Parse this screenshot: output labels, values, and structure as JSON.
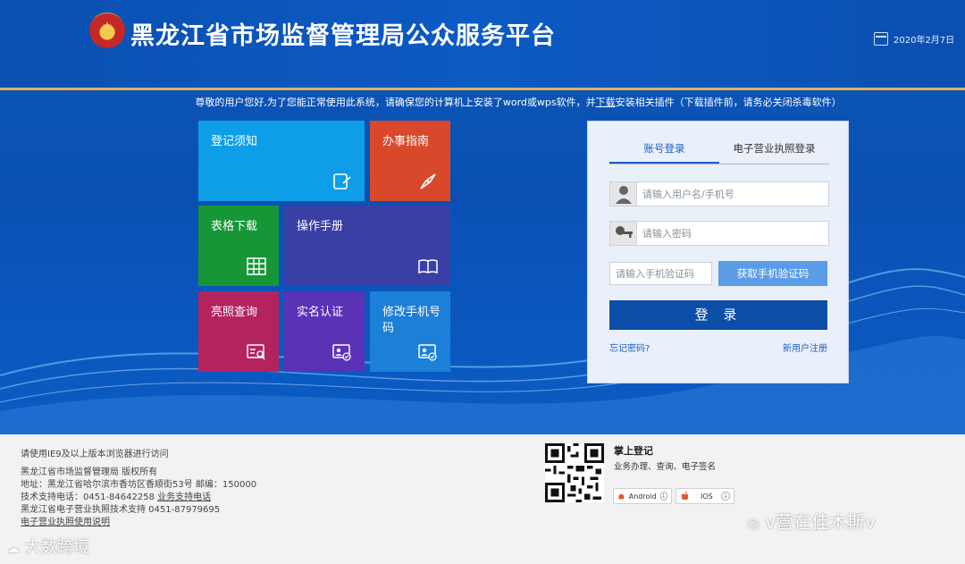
{
  "header": {
    "title": "黑龙江省市场监督管理局公众服务平台",
    "date": "2020年2月7日"
  },
  "notice": {
    "before": "尊敬的用户您好,为了您能正常使用此系统，请确保您的计算机上安装了word或wps软件，并",
    "link": "下载",
    "after": "安装相关插件（下载插件前，请务必关闭杀毒软件）"
  },
  "tiles": {
    "registration_notice": {
      "label": "登记须知",
      "color": "#0e9ee8"
    },
    "service_guide": {
      "label": "办事指南",
      "color": "#d9482a"
    },
    "form_download": {
      "label": "表格下载",
      "color": "#169637"
    },
    "user_manual": {
      "label": "操作手册",
      "color": "#3a3fa6"
    },
    "license_query": {
      "label": "亮照查询",
      "color": "#b5235e"
    },
    "realname_auth": {
      "label": "实名认证",
      "color": "#5a32b5"
    },
    "change_phone": {
      "label": "修改手机号码",
      "color": "#1c7fd8"
    }
  },
  "login": {
    "tab_account": "账号登录",
    "tab_license": "电子营业执照登录",
    "username_placeholder": "请输入用户名/手机号",
    "password_placeholder": "请输入密码",
    "sms_placeholder": "请输入手机验证码",
    "get_code": "获取手机验证码",
    "submit": "登 录",
    "forgot": "忘记密码?",
    "register": "新用户注册"
  },
  "footer": {
    "browser_tip": "请使用IE9及以上版本浏览器进行访问",
    "copyright": "黑龙江省市场监督管理局 版权所有",
    "address": "地址：黑龙江省哈尔滨市香坊区香顺街53号 邮编：150000",
    "tech_phone": "技术支持电话：0451-84642258",
    "biz_phone": "业务支持电话",
    "license_support": "黑龙江省电子营业执照技术支持 0451-87979695",
    "license_manual": "电子营业执照使用说明",
    "app_title": "掌上登记",
    "app_sub": "业务办理、查询、电子签名",
    "android": "Android",
    "ios": "IOS"
  },
  "watermarks": {
    "left": "大数跨境",
    "right": "v营在佳木斯v"
  }
}
